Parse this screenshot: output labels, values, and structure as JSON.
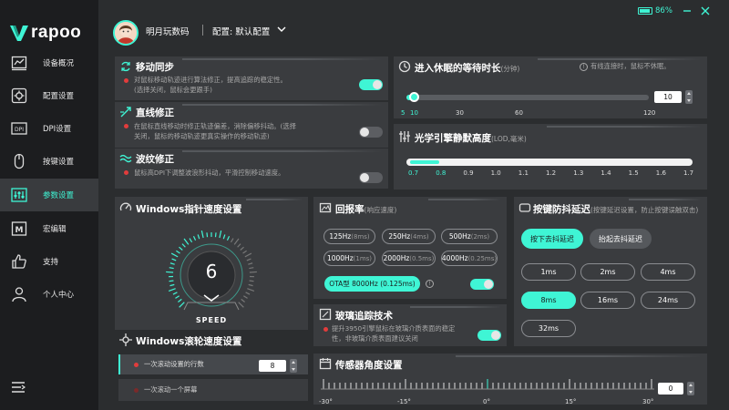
{
  "app": {
    "logo_text": "rapoo",
    "brand_color": "#3ff5d5"
  },
  "sidebar": {
    "items": [
      {
        "label": "设备概况",
        "icon": "chart-icon"
      },
      {
        "label": "配置设置",
        "icon": "settings-gear-icon"
      },
      {
        "label": "DPI设置",
        "icon": "dpi-icon"
      },
      {
        "label": "按键设置",
        "icon": "mouse-icon"
      },
      {
        "label": "参数设置",
        "icon": "sliders-icon",
        "active": true
      },
      {
        "label": "宏编辑",
        "icon": "macro-icon"
      },
      {
        "label": "支持",
        "icon": "thumbs-up-icon"
      },
      {
        "label": "个人中心",
        "icon": "person-icon"
      }
    ],
    "menu_icon": "menu-collapse-icon"
  },
  "header": {
    "username": "明月玩数码",
    "config_label": "配置: 默认配置",
    "battery_text": "86%",
    "battery_level": 0.86
  },
  "mobile_sync": {
    "title": "移动同步",
    "desc": "对鼠标移动轨迹进行算法修正，提高追踪的稳定性。(选择关闭，鼠标会更跟手)",
    "enabled": true
  },
  "straight": {
    "title": "直线修正",
    "desc": "在鼠标直线移动时修正轨迹偏差，消除偏移抖动。(选择关闭，鼠标的移动轨迹更真实操作的移动轨迹)",
    "enabled": false
  },
  "ripple": {
    "title": "波纹修正",
    "desc": "鼠标高DPI下调整波浪形抖动，平滑控制移动速度。",
    "enabled": false
  },
  "sleep": {
    "title": "进入休眠的等待时长",
    "unit": "(分钟)",
    "info": "有线连接时，鼠标不休眠。",
    "value": "10",
    "ticks": [
      "5",
      "10",
      "30",
      "60",
      "120"
    ]
  },
  "lod": {
    "title": "光学引擎静默高度",
    "unit": "(LOD,毫米)",
    "ticks": [
      "0.7",
      "0.8",
      "0.9",
      "1.0",
      "1.1",
      "1.2",
      "1.3",
      "1.4",
      "1.5",
      "1.6",
      "1.7"
    ],
    "value": 0.8
  },
  "pointer_speed": {
    "title": "Windows指针速度设置",
    "value": "6",
    "label": "SPEED",
    "max": 10
  },
  "scroll_speed": {
    "title": "Windows滚轮速度设置",
    "option1": "一次滚动设置的行数",
    "option1_value": "8",
    "option2": "一次滚动一个屏幕"
  },
  "polling": {
    "title": "回报率",
    "subtitle": "(响应速度)",
    "options": [
      {
        "rate": "125Hz",
        "ms": "(8ms)"
      },
      {
        "rate": "250Hz",
        "ms": "(4ms)"
      },
      {
        "rate": "500Hz",
        "ms": "(2ms)"
      },
      {
        "rate": "1000Hz",
        "ms": "(1ms)"
      },
      {
        "rate": "2000Hz",
        "ms": "(0.5ms)"
      },
      {
        "rate": "4000Hz",
        "ms": "(0.25ms)"
      }
    ],
    "ota": "OTA型 8000Hz (0.125ms)",
    "ota_enabled": true
  },
  "glass": {
    "title": "玻璃追踪技术",
    "desc": "提升3950引擎鼠标在玻璃介质表面的稳定性，非玻璃介质表面建议关闭",
    "enabled": true
  },
  "debounce": {
    "title": "按键防抖延迟",
    "subtitle": "(按键延迟设置，防止按键误触双击)",
    "press_label": "按下去抖延迟",
    "release_label": "抬起去抖延迟",
    "options": [
      "1ms",
      "2ms",
      "4ms",
      "8ms",
      "16ms",
      "24ms",
      "32ms"
    ],
    "selected": "8ms"
  },
  "sensor_angle": {
    "title": "传感器角度设置",
    "ticks": [
      "-30°",
      "-15°",
      "0°",
      "15°",
      "30°"
    ],
    "value": "0"
  }
}
